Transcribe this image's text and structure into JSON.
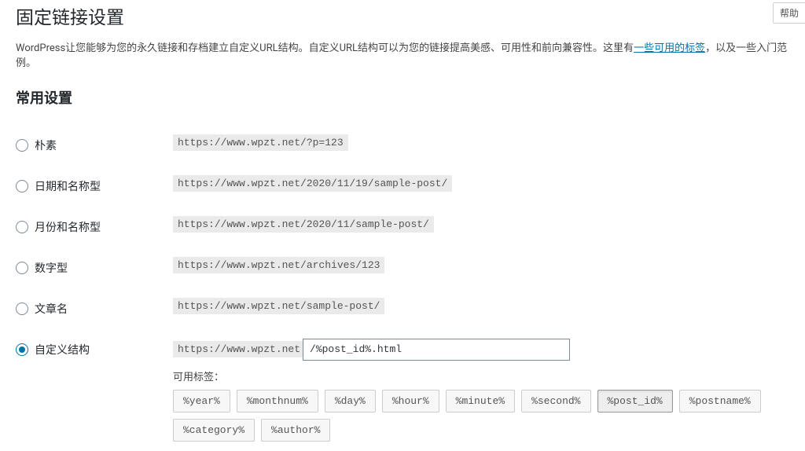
{
  "help_button": "帮助",
  "page_title": "固定链接设置",
  "description": {
    "before_link": "WordPress让您能够为您的永久链接和存档建立自定义URL结构。自定义URL结构可以为您的链接提高美感、可用性和前向兼容性。这里有",
    "link_text": "一些可用的标签",
    "after_link": "，以及一些入门范例。"
  },
  "section_heading": "常用设置",
  "options": {
    "plain": {
      "label": "朴素",
      "code": "https://www.wpzt.net/?p=123"
    },
    "day_name": {
      "label": "日期和名称型",
      "code": "https://www.wpzt.net/2020/11/19/sample-post/"
    },
    "month_name": {
      "label": "月份和名称型",
      "code": "https://www.wpzt.net/2020/11/sample-post/"
    },
    "numeric": {
      "label": "数字型",
      "code": "https://www.wpzt.net/archives/123"
    },
    "post_name": {
      "label": "文章名",
      "code": "https://www.wpzt.net/sample-post/"
    },
    "custom": {
      "label": "自定义结构",
      "base_url": "https://www.wpzt.net",
      "input_value": "/%post_id%.html",
      "tags_label": "可用标签："
    }
  },
  "tags": [
    "%year%",
    "%monthnum%",
    "%day%",
    "%hour%",
    "%minute%",
    "%second%",
    "%post_id%",
    "%postname%",
    "%category%",
    "%author%"
  ],
  "active_tag": "%post_id%"
}
